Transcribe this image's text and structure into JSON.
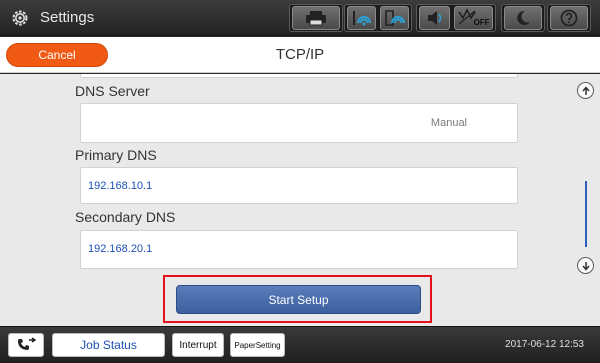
{
  "topbar": {
    "title": "Settings",
    "icons": [
      "settings-gear-icon",
      "printer-icon",
      "wifi-icon",
      "wifi-direct-icon",
      "volume-icon",
      "quiet-mode-off-icon",
      "sleep-moon-icon",
      "help-icon"
    ],
    "quiet_label": "OFF"
  },
  "header": {
    "cancel_label": "Cancel",
    "title": "TCP/IP"
  },
  "form": {
    "dns_server_label": "DNS Server",
    "dns_server_value": "Manual",
    "primary_dns_label": "Primary DNS",
    "primary_dns_value": "192.168.10.1",
    "secondary_dns_label": "Secondary DNS",
    "secondary_dns_value": "192.168.20.1",
    "start_setup_label": "Start Setup"
  },
  "bottombar": {
    "job_status_label": "Job Status",
    "interrupt_label": "Interrupt",
    "paper_setting_label": "PaperSetting",
    "datetime": "2017-06-12 12:53"
  },
  "colors": {
    "accent_orange": "#f05a14",
    "value_blue": "#1e50b4",
    "start_button_blue": "#4a6cad",
    "highlight_red": "#e2101a"
  }
}
